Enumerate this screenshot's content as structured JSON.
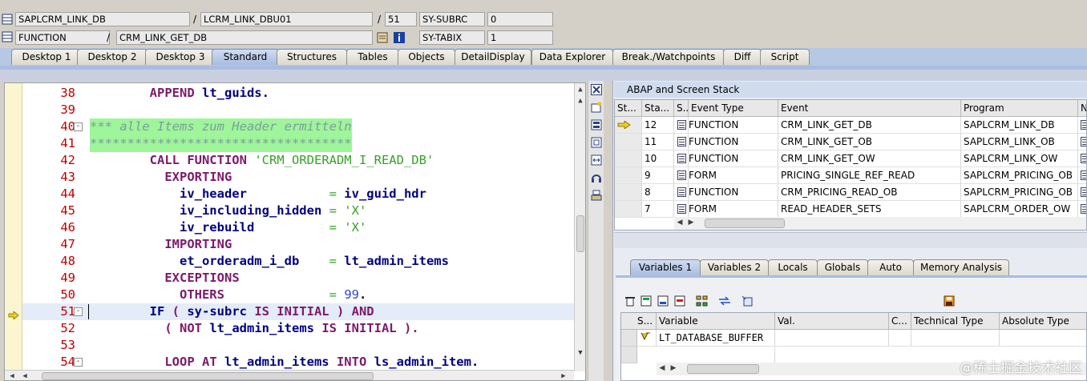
{
  "header": {
    "row1": {
      "program": "SAPLCRM_LINK_DB",
      "include": "LCRM_LINK_DBU01",
      "line": "51",
      "sy_field": "SY-SUBRC",
      "sy_value": "0"
    },
    "row2": {
      "event_type": "FUNCTION",
      "event": "CRM_LINK_GET_DB",
      "sy_field": "SY-TABIX",
      "sy_value": "1"
    },
    "separator": "/"
  },
  "tabs": [
    "Desktop 1",
    "Desktop 2",
    "Desktop 3",
    "Standard",
    "Structures",
    "Tables",
    "Objects",
    "DetailDisplay",
    "Data Explorer",
    "Break./Watchpoints",
    "Diff",
    "Script"
  ],
  "active_tab": "Standard",
  "editor": {
    "lines": [
      {
        "no": "38",
        "tokens": [
          [
            "        ",
            ""
          ],
          [
            "APPEND",
            "kw"
          ],
          [
            " lt_guids.",
            "ident"
          ]
        ]
      },
      {
        "no": "39",
        "tokens": []
      },
      {
        "no": "40",
        "fold": "-",
        "comment": true,
        "tokens": [
          [
            "*** alle Items zum Header ermitteln",
            "cmt"
          ]
        ]
      },
      {
        "no": "41",
        "comment": true,
        "tokens": [
          [
            "***********************************",
            "cmt"
          ]
        ]
      },
      {
        "no": "42",
        "tokens": [
          [
            "        ",
            ""
          ],
          [
            "CALL FUNCTION",
            "kw"
          ],
          [
            " ",
            ""
          ],
          [
            "'CRM_ORDERADM_I_READ_DB'",
            "str"
          ]
        ]
      },
      {
        "no": "43",
        "tokens": [
          [
            "          ",
            ""
          ],
          [
            "EXPORTING",
            "kw"
          ]
        ]
      },
      {
        "no": "44",
        "tokens": [
          [
            "            ",
            ""
          ],
          [
            "iv_header           ",
            "ident"
          ],
          [
            "= ",
            "str"
          ],
          [
            "iv_guid_hdr",
            "ident"
          ]
        ]
      },
      {
        "no": "45",
        "tokens": [
          [
            "            ",
            ""
          ],
          [
            "iv_including_hidden ",
            "ident"
          ],
          [
            "= ",
            "str"
          ],
          [
            "'X'",
            "str"
          ]
        ]
      },
      {
        "no": "46",
        "tokens": [
          [
            "            ",
            ""
          ],
          [
            "iv_rebuild          ",
            "ident"
          ],
          [
            "= ",
            "str"
          ],
          [
            "'X'",
            "str"
          ]
        ]
      },
      {
        "no": "47",
        "tokens": [
          [
            "          ",
            ""
          ],
          [
            "IMPORTING",
            "kw"
          ]
        ]
      },
      {
        "no": "48",
        "tokens": [
          [
            "            ",
            ""
          ],
          [
            "et_orderadm_i_db    ",
            "ident"
          ],
          [
            "= ",
            "str"
          ],
          [
            "lt_admin_items",
            "ident"
          ]
        ]
      },
      {
        "no": "49",
        "tokens": [
          [
            "          ",
            ""
          ],
          [
            "EXCEPTIONS",
            "kw"
          ]
        ]
      },
      {
        "no": "50",
        "tokens": [
          [
            "            ",
            ""
          ],
          [
            "OTHERS",
            "kw"
          ],
          [
            "              ",
            ""
          ],
          [
            "= ",
            "str"
          ],
          [
            "99",
            "num"
          ],
          [
            ".",
            "ident"
          ]
        ]
      },
      {
        "no": "51",
        "fold": "-",
        "current": true,
        "tokens": [
          [
            "        ",
            ""
          ],
          [
            "IF",
            "ident"
          ],
          [
            " ( ",
            "kw"
          ],
          [
            "sy-subrc",
            "ident"
          ],
          [
            " IS INITIAL",
            "kw"
          ],
          [
            " ) ",
            "kw"
          ],
          [
            "AND",
            "kw"
          ]
        ]
      },
      {
        "no": "52",
        "tokens": [
          [
            "          ",
            ""
          ],
          [
            "( ",
            "kw"
          ],
          [
            "NOT",
            "kw"
          ],
          [
            " lt_admin_items ",
            "ident"
          ],
          [
            "IS INITIAL",
            "kw"
          ],
          [
            " ).",
            "kw"
          ]
        ]
      },
      {
        "no": "53",
        "tokens": []
      },
      {
        "no": "54",
        "fold": "-",
        "tokens": [
          [
            "          ",
            ""
          ],
          [
            "LOOP AT",
            "kw"
          ],
          [
            " lt_admin_items ",
            "ident"
          ],
          [
            "INTO",
            "kw"
          ],
          [
            " ls_admin_item.",
            "ident"
          ]
        ]
      }
    ]
  },
  "stack": {
    "title": "ABAP and Screen Stack",
    "columns": [
      "St...",
      "Sta...",
      "S...",
      "Event Type",
      "Event",
      "Program",
      "Na"
    ],
    "rows": [
      {
        "current": true,
        "level": "12",
        "type": "FUNCTION",
        "event": "CRM_LINK_GET_DB",
        "program": "SAPLCRM_LINK_DB"
      },
      {
        "level": "11",
        "type": "FUNCTION",
        "event": "CRM_LINK_GET_OB",
        "program": "SAPLCRM_LINK_OB"
      },
      {
        "level": "10",
        "type": "FUNCTION",
        "event": "CRM_LINK_GET_OW",
        "program": "SAPLCRM_LINK_OW"
      },
      {
        "level": "9",
        "type": "FORM",
        "event": "PRICING_SINGLE_REF_READ",
        "program": "SAPLCRM_PRICING_OB"
      },
      {
        "level": "8",
        "type": "FUNCTION",
        "event": "CRM_PRICING_READ_OB",
        "program": "SAPLCRM_PRICING_OB"
      },
      {
        "level": "7",
        "type": "FORM",
        "event": "READ_HEADER_SETS",
        "program": "SAPLCRM_ORDER_OW"
      }
    ]
  },
  "var_tabs": [
    "Variables 1",
    "Variables 2",
    "Locals",
    "Globals",
    "Auto",
    "Memory Analysis"
  ],
  "active_var_tab": "Variables 1",
  "variables": {
    "columns": [
      "S...",
      "Variable",
      "Val.",
      "C...",
      "Technical Type",
      "Absolute Type"
    ],
    "rows": [
      {
        "variable": "LT_DATABASE_BUFFER",
        "value": "",
        "technical_type": "",
        "absolute_type": ""
      }
    ]
  },
  "watermark": "@稀土掘金技术社区",
  "colors": {
    "current_line": "#e3ecf8",
    "comment_bg": "#9ef59a",
    "tab_active": "#a8bde0",
    "line_number": "#c00000"
  }
}
